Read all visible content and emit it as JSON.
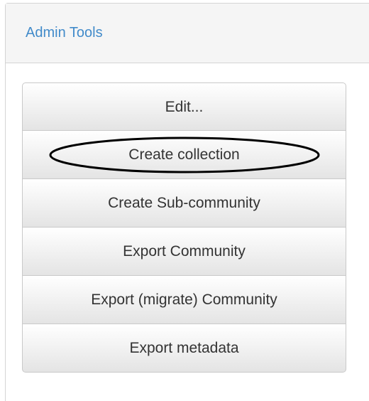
{
  "panel": {
    "title": "Admin Tools"
  },
  "buttons": [
    {
      "label": "Edit..."
    },
    {
      "label": "Create collection",
      "highlighted": true
    },
    {
      "label": "Create Sub-community"
    },
    {
      "label": "Export Community"
    },
    {
      "label": "Export (migrate) Community"
    },
    {
      "label": "Export metadata"
    }
  ],
  "colors": {
    "title": "#428bca",
    "button_text": "#333333",
    "heading_bg": "#f5f5f5",
    "highlight_oval": "#000000"
  }
}
